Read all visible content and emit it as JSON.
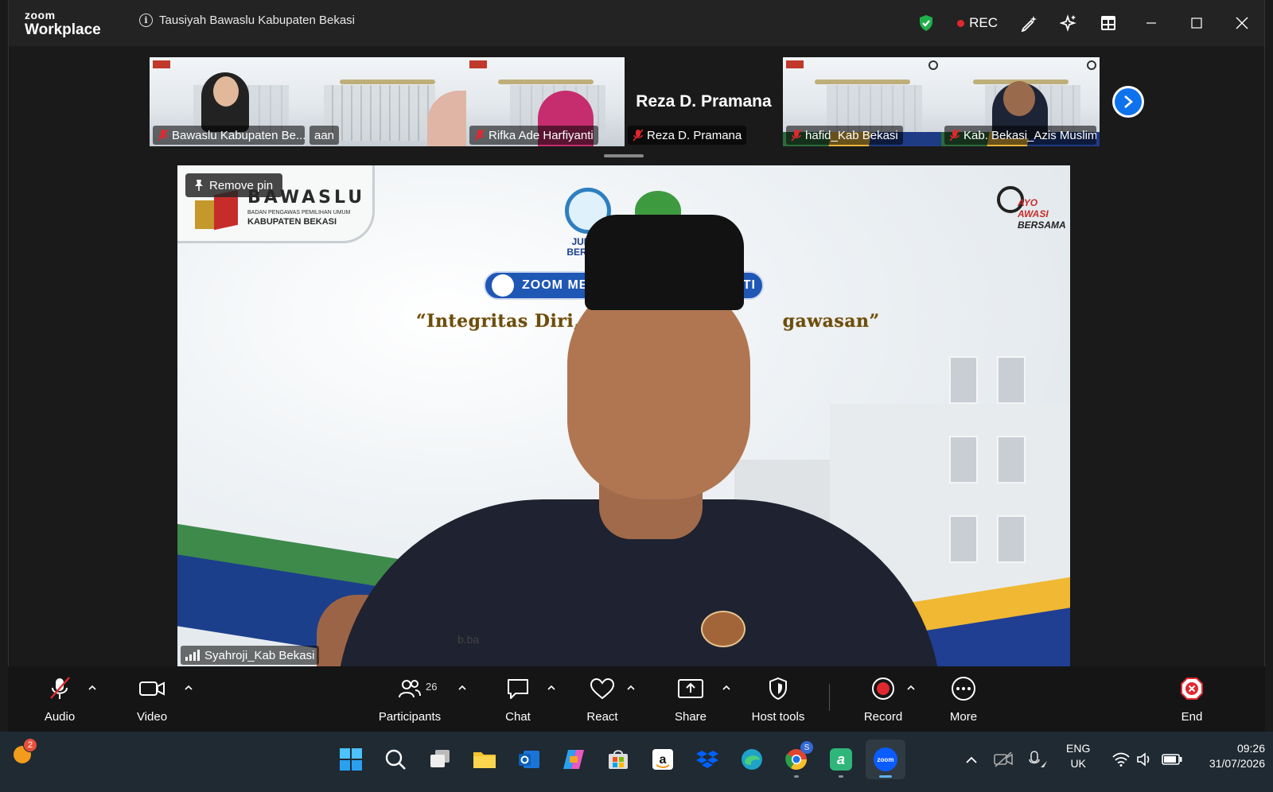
{
  "window": {
    "brand_top": "zoom",
    "brand_bottom": "Workplace",
    "meeting_title": "Tausiyah Bawaslu Kabupaten Bekasi",
    "rec_label": "REC"
  },
  "thumbnails": [
    {
      "label": "Bawaslu Kabupaten Be..."
    },
    {
      "label": "aan"
    },
    {
      "label": "Rifka Ade Harfiyanti"
    },
    {
      "label": "Reza D. Pramana",
      "big_name": "Reza D. Pramana"
    },
    {
      "label": "hafid_Kab Bekasi"
    },
    {
      "label": "Kab. Bekasi_Azis Muslim"
    }
  ],
  "main_video": {
    "pin_label": "Remove pin",
    "speaker_name": "Syahroji_Kab Bekasi",
    "bg": {
      "logo_big": "BAWASLU",
      "logo_small": "BADAN PENGAWAS PEMILIHAN UMUM",
      "logo_mid": "KABUPATEN BEKASI",
      "jumpa_line1": "JUMPA",
      "jumpa_line2": "BERLIAN",
      "zoom_pill_text": "ZOOM MEET",
      "zoom_pill_tail": "ATI",
      "quote_left": "“Integritas Diri, K",
      "quote_right": "gawasan”",
      "ayo_line1": "AYO",
      "ayo_line2": "AWASI",
      "ayo_line3": "BERSAMA",
      "web_text": "b.ba"
    }
  },
  "toolbar": {
    "audio": "Audio",
    "video": "Video",
    "participants": "Participants",
    "participants_count": "26",
    "chat": "Chat",
    "react": "React",
    "share": "Share",
    "host_tools": "Host tools",
    "record": "Record",
    "more": "More",
    "end": "End"
  },
  "taskbar": {
    "notification_count": "2",
    "chrome_badge": "S",
    "lang_line1": "ENG",
    "lang_line2": "UK",
    "time": "09:26",
    "date": "31/07/2026"
  },
  "colors": {
    "zoom_blue": "#0e72ed",
    "record_red": "#e0282e",
    "shield_green": "#1fb04b",
    "end_red": "#e0282e"
  }
}
